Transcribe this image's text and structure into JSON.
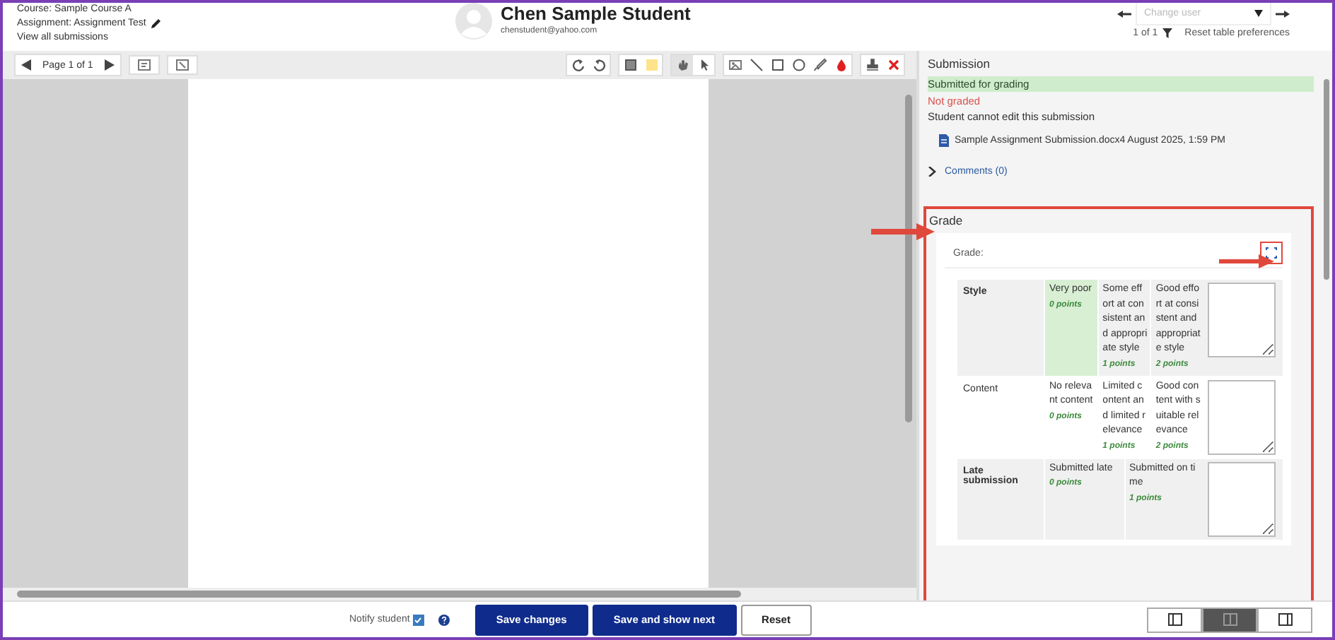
{
  "header": {
    "course": "Course: Sample Course A",
    "assignment": "Assignment: Assignment Test",
    "view_all": "View all submissions",
    "student_name": "Chen Sample Student",
    "student_email": "chenstudent@yahoo.com",
    "change_user": {
      "placeholder": "Change user"
    },
    "count": "1 of 1",
    "reset": "Reset table preferences"
  },
  "pdf_toolbar": {
    "page": "Page 1 of 1",
    "tool_groups": [
      [
        {
          "kind": "rotate-left",
          "selected": false
        },
        {
          "kind": "rotate-right",
          "selected": false
        }
      ],
      [
        {
          "kind": "comment",
          "selected": false
        },
        {
          "kind": "swatch",
          "selected": false
        }
      ],
      [
        {
          "kind": "hand",
          "selected": true
        },
        {
          "kind": "pointer",
          "selected": false
        }
      ],
      [
        {
          "kind": "stamp-image",
          "selected": false
        },
        {
          "kind": "line",
          "selected": false
        },
        {
          "kind": "rectangle",
          "selected": false
        },
        {
          "kind": "oval",
          "selected": false
        },
        {
          "kind": "pen",
          "selected": false
        },
        {
          "kind": "drop",
          "selected": false
        }
      ],
      [
        {
          "kind": "stamp",
          "selected": false
        },
        {
          "kind": "delete",
          "selected": false
        }
      ]
    ]
  },
  "submission": {
    "title": "Submission",
    "status": "Submitted for grading",
    "grading": "Not graded",
    "edit_note": "Student cannot edit this submission",
    "file_name": "Sample Assignment Submission.docx",
    "file_date": "4 August 2025, 1:59 PM",
    "comments": {
      "label": "Comments (0)",
      "expanded": false
    }
  },
  "grade": {
    "title": "Grade",
    "label": "Grade:",
    "rubric": [
      {
        "criterion": "Style",
        "levels": [
          {
            "text": "Very poor",
            "points": "0 points",
            "selected": true
          },
          {
            "text": "Some effort at consistent and appropriate style",
            "points": "1 points",
            "selected": false
          },
          {
            "text": "Good effort at consistent and appropriate style",
            "points": "2 points",
            "selected": false
          }
        ]
      },
      {
        "criterion": "Content",
        "levels": [
          {
            "text": "No relevant content",
            "points": "0 points",
            "selected": false
          },
          {
            "text": "Limited content and limited relevance",
            "points": "1 points",
            "selected": false
          },
          {
            "text": "Good content with suitable relevance",
            "points": "2 points",
            "selected": false
          }
        ]
      },
      {
        "criterion": "Late submission",
        "levels": [
          {
            "text": "Submitted late",
            "points": "0 points",
            "selected": false
          },
          {
            "text": "Submitted on time",
            "points": "1 points",
            "selected": false
          }
        ]
      }
    ]
  },
  "footer": {
    "notify": {
      "label": "Notify student",
      "checked": true
    },
    "buttons": [
      {
        "label": "Save changes",
        "kind": "primary"
      },
      {
        "label": "Save and show next",
        "kind": "primary"
      },
      {
        "label": "Reset",
        "kind": "secondary"
      }
    ],
    "layout_buttons": [
      {
        "kind": "left-panel",
        "selected": false
      },
      {
        "kind": "both-panels",
        "selected": true
      },
      {
        "kind": "right-panel",
        "selected": false
      }
    ]
  }
}
